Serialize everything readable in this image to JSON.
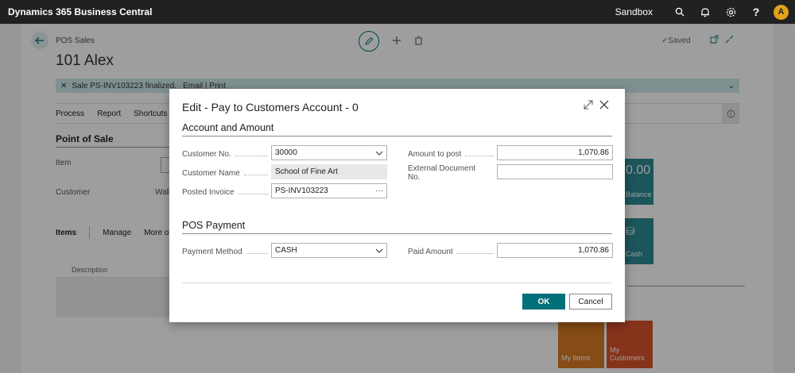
{
  "app": {
    "title": "Dynamics 365 Business Central",
    "environment": "Sandbox",
    "avatar_initial": "A"
  },
  "page": {
    "breadcrumb": "POS Sales",
    "title": "101 Alex",
    "saved_status": "Saved",
    "notification": {
      "text": "Sale PS-INV103223 finalized.",
      "links": "Email | Print"
    },
    "action_bar": [
      "Process",
      "Report",
      "Shortcuts"
    ],
    "point_of_sale_header": "Point of Sale",
    "item_label": "Item",
    "customer_label": "Customer",
    "customer_value": "Wall",
    "items_tab": "Items",
    "manage_label": "Manage",
    "more_options_label": "More op",
    "grid_column_description": "Description",
    "tiles": {
      "balance_value": "0.00",
      "balance_label": "Balance",
      "cash_label": "Cash",
      "my_items": "My Items",
      "my_customers": "My Customers"
    }
  },
  "dialog": {
    "title": "Edit - Pay to Customers Account - 0",
    "section_account": "Account and Amount",
    "section_payment": "POS Payment",
    "fields": {
      "customer_no": {
        "label": "Customer No.",
        "value": "30000"
      },
      "customer_name": {
        "label": "Customer Name",
        "value": "School of Fine Art"
      },
      "posted_invoice": {
        "label": "Posted Invoice",
        "value": "PS-INV103223"
      },
      "amount_to_post": {
        "label": "Amount to post",
        "value": "1,070.86"
      },
      "external_doc_no": {
        "label": "External Document No.",
        "value": ""
      },
      "payment_method": {
        "label": "Payment Method",
        "value": "CASH"
      },
      "paid_amount": {
        "label": "Paid Amount",
        "value": "1,070.86"
      }
    },
    "ok_label": "OK",
    "cancel_label": "Cancel"
  }
}
